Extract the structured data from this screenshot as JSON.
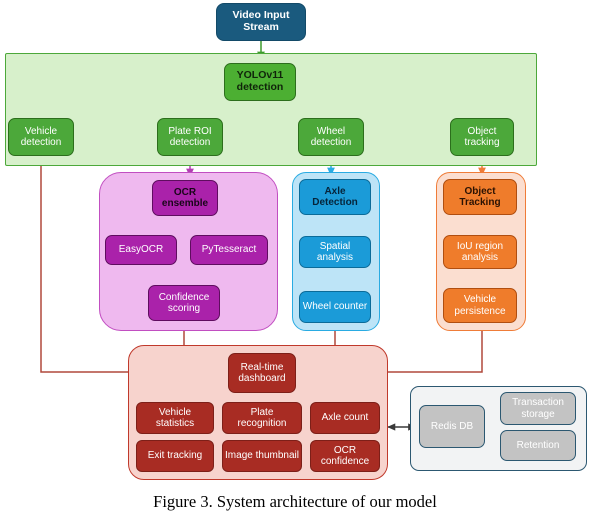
{
  "figure": {
    "caption": "Figure 3. System architecture of our model"
  },
  "nodes": {
    "video_input": "Video Input Stream",
    "yolo": "YOLOv11 detection",
    "detection_row": [
      "Vehicle detection",
      "Plate ROI detection",
      "Wheel detection",
      "Object tracking"
    ],
    "ocr": {
      "ensemble": "OCR ensemble",
      "easyocr": "EasyOCR",
      "pytesseract": "PyTesseract",
      "confidence": "Confidence scoring"
    },
    "axle": {
      "detection": "Axle Detection",
      "spatial": "Spatial analysis",
      "wheel_counter": "Wheel counter"
    },
    "tracking": {
      "object_tracking": "Object Tracking",
      "iou": "IoU region analysis",
      "persistence": "Vehicle persistence"
    },
    "dashboard": {
      "title": "Real-time dashboard",
      "tiles": [
        "Vehicle statistics",
        "Plate recognition",
        "Axle count",
        "Exit tracking",
        "Image thumbnail",
        "OCR confidence"
      ]
    },
    "database": {
      "redis": "Redis DB",
      "transaction_storage": "Transaction storage",
      "retention": "Retention"
    }
  },
  "colors": {
    "video_input": "#1a5a7e",
    "yolo_box": "#4caf32",
    "detection_box": "#4ca83a",
    "green_panel": "#d7f0cb",
    "purple_box": "#aa22aa",
    "purple_panel": "#efb9ef",
    "blue_box": "#1b9bd8",
    "blue_panel": "#bde4f7",
    "orange_box": "#ef7c2b",
    "orange_panel": "#fbded0",
    "red_box": "#a82c23",
    "red_panel": "#f7d3cd",
    "db_box": "#c3c3c3",
    "db_panel": "#f2f3f4"
  }
}
